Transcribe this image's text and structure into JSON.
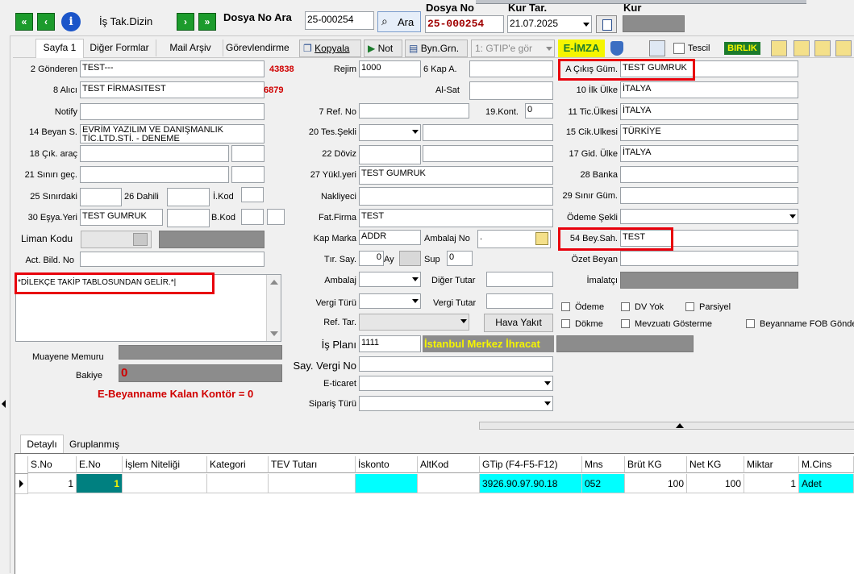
{
  "topbar": {
    "is_takip_label": "İş Tak.Dizin",
    "dosya_no_ara_label": "Dosya No Ara",
    "search_value": "25-000254",
    "ara_button": "Ara",
    "dosya_no_label": "Dosya No",
    "dosya_no_value": "25-000254",
    "kur_tar_label": "Kur Tar.",
    "kur_tar_value": "21.07.2025",
    "kur_label": "Kur"
  },
  "tabs": [
    "Sayfa 1",
    "Diğer Formlar",
    "Mail Arşiv",
    "Görevlendirme"
  ],
  "toolbar": {
    "kopyala": "Kopyala",
    "not": "Not",
    "byn_grn": "Byn.Grn.",
    "gtip_combo": "1: GTIP'e gör",
    "eimza": "E-İMZA",
    "tescil": "Tescil",
    "birlik": "BIRLIK"
  },
  "left": {
    "gonderen_label": "2 Gönderen",
    "gonderen_value": "TEST---",
    "gonderen_code": "43838",
    "alici_label": "8 Alıcı",
    "alici_value": "TEST FİRMASITEST",
    "alici_code": "6879",
    "notify_label": "Notify",
    "beyan_label": "14 Beyan S.",
    "beyan_value1": "EVRİM YAZILIM VE DANIŞMANLIK",
    "beyan_value2": "TİC.LTD.STİ. - DENEME",
    "cik_arac_label": "18 Çık. araç",
    "sinir_gec_label": "21 Sınırı geç.",
    "sinirdaki_label": "25 Sınırdaki",
    "dahili_label": "26 Dahili",
    "ikod_label": "İ.Kod",
    "esya_yeri_label": "30 Eşya.Yeri",
    "esya_yeri_value": "TEST GUMRUK",
    "bkod_label": "B.Kod",
    "liman_kodu_label": "Liman Kodu",
    "act_bild_label": "Act. Bild. No",
    "memo_text": "*DİLEKÇE TAKİP TABLOSUNDAN GELİR.*|",
    "muayene_label": "Muayene Memuru",
    "bakiye_label": "Bakiye",
    "bakiye_value": "0",
    "kontor_text": "E-Beyanname Kalan Kontör = 0"
  },
  "middle": {
    "rejim_label": "Rejim",
    "rejim_value": "1000",
    "kap_a_label": "6 Kap A.",
    "al_sat_label": "Al-Sat",
    "ref_no_label": "7 Ref. No",
    "kont_label": "19.Kont.",
    "kont_value": "0",
    "tes_sekli_label": "20 Tes.Şekli",
    "doviz_label": "22 Döviz",
    "yukl_yeri_label": "27 Yükl.yeri",
    "yukl_yeri_value": "TEST GUMRUK",
    "nakliyeci_label": "Nakliyeci",
    "fat_firma_label": "Fat.Firma",
    "fat_firma_value": "TEST",
    "kap_marka_label": "Kap Marka",
    "kap_marka_value": "ADDR",
    "ambalaj_no_label": "Ambalaj No",
    "ambalaj_no_value": ".",
    "tir_say_label": "Tır. Say.",
    "tir_say_value": "0",
    "ay_label": "Ay",
    "sup_label": "Sup",
    "sup_value": "0",
    "ambalaj_label": "Ambalaj",
    "diger_tutar_label": "Diğer Tutar",
    "vergi_turu_label": "Vergi Türü",
    "vergi_tutar_label": "Vergi Tutar",
    "ref_tar_label": "Ref. Tar.",
    "hava_yakit_button": "Hava Yakıt",
    "is_plani_label": "İş Planı",
    "is_plani_value": "1111",
    "is_plani_name": "İstanbul Merkez İhracat",
    "say_vergi_label": "Say. Vergi No",
    "e_ticaret_label": "E-ticaret",
    "siparis_label": "Sipariş Türü"
  },
  "right": {
    "cikis_gum_label": "A Çıkış Güm.",
    "cikis_gum_value": "TEST GUMRUK",
    "ilk_ulke_label": "10 İlk Ülke",
    "ilk_ulke_value": "İTALYA",
    "tic_ulkesi_label": "11 Tic.Ülkesi",
    "tic_ulkesi_value": "İTALYA",
    "cik_ulkesi_label": "15 Cik.Ulkesi",
    "cik_ulkesi_value": "TÜRKİYE",
    "gid_ulke_label": "17 Gid. Ülke",
    "gid_ulke_value": "İTALYA",
    "banka_label": "28 Banka",
    "sinir_gum_label": "29 Sınır Güm.",
    "odeme_sekli_label": "Ödeme Şekli",
    "bey_sah_label": "54 Bey.Sah.",
    "bey_sah_value": "TEST",
    "ozet_beyan_label": "Özet Beyan",
    "imalatci_label": "İmalatçı",
    "cb_odeme": "Ödeme",
    "cb_dv_yok": "DV Yok",
    "cb_parsiyel": "Parsiyel",
    "cb_dokme": "Dökme",
    "cb_mevzuati": "Mevzuatı Gösterme",
    "cb_fob": "Beyanname FOB Gönder"
  },
  "bottom_tabs": [
    "Detaylı",
    "Gruplanmış"
  ],
  "grid": {
    "headers": [
      "S.No",
      "E.No",
      "İşlem Niteliği",
      "Kategori",
      "TEV Tutarı",
      "İskonto",
      "AltKod",
      "GTip (F4-F5-F12)",
      "Mns",
      "Brüt KG",
      "Net KG",
      "Miktar",
      "M.Cins"
    ],
    "row": [
      "1",
      "1",
      "",
      "",
      "",
      "",
      "",
      "3926.90.97.90.18",
      "052",
      "100",
      "100",
      "1",
      "Adet"
    ]
  },
  "colors": {
    "accent_red": "#e8000b",
    "grid_cyan": "#00ffff",
    "selected_teal": "#008080",
    "gtip_highlight": "#f5f500"
  }
}
